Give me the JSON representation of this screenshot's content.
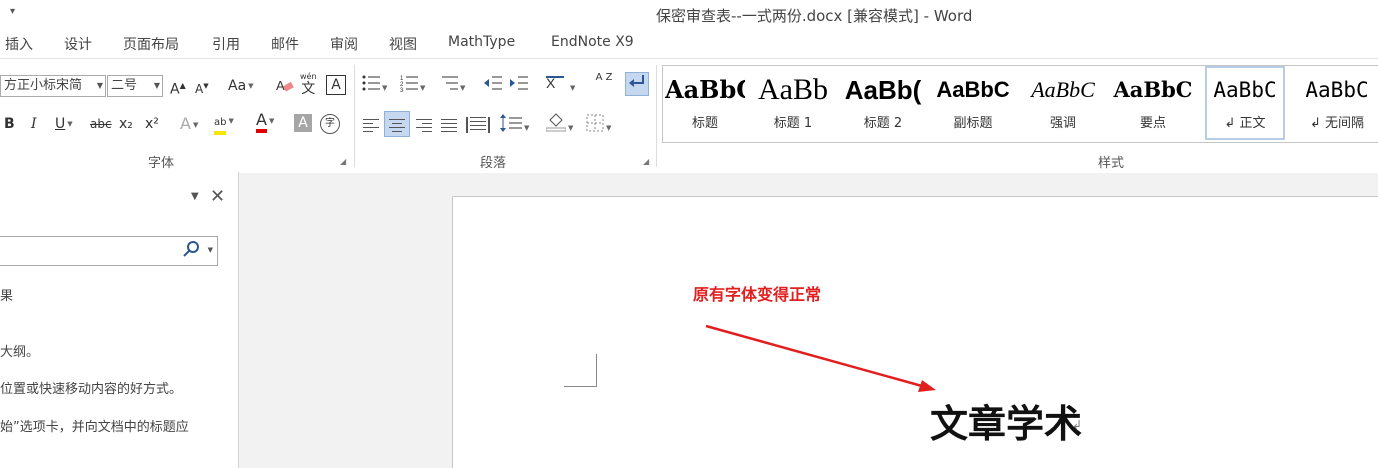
{
  "titlebar": {
    "title": "保密审查表--一式两份.docx [兼容模式] - Word"
  },
  "tabs": [
    "插入",
    "设计",
    "页面布局",
    "引用",
    "邮件",
    "审阅",
    "视图",
    "MathType",
    "EndNote X9"
  ],
  "font": {
    "font_name": "方正小标宋简",
    "font_size": "二号",
    "grow_label": "A",
    "shrink_label": "A",
    "case_label": "Aa",
    "wen_label": "wén",
    "wen_char": "文",
    "border_char": "A",
    "bold": "B",
    "italic": "I",
    "underline": "U",
    "strike": "abc",
    "sub": "x₂",
    "sup": "x²",
    "effects": "A",
    "highlight": "ab",
    "font_color": "A",
    "shading": "A",
    "circled": "字",
    "group_label": "字体"
  },
  "paragraph": {
    "group_label": "段落",
    "sort_az": "A Z",
    "highlight_color": "#c5d8ef"
  },
  "styles": {
    "group_label": "样式",
    "items": [
      {
        "preview": "AaBbC",
        "name": "标题"
      },
      {
        "preview": "AaBb",
        "name": "标题 1"
      },
      {
        "preview": "AaBb(",
        "name": "标题 2"
      },
      {
        "preview": "AaBbC",
        "name": "副标题"
      },
      {
        "preview": "AaBbC",
        "name": "强调"
      },
      {
        "preview": "AaBbC",
        "name": "要点"
      },
      {
        "preview": "AaBbC",
        "name": "↲ 正文"
      },
      {
        "preview": "AaBbC",
        "name": "↲ 无间隔"
      }
    ]
  },
  "navpane": {
    "lines": [
      "果",
      "大纲。",
      "位置或快速移动内容的好方式。",
      "始”选项卡，并向文档中的标题应"
    ]
  },
  "document": {
    "annotation": "原有字体变得正常",
    "heading": "文章学术",
    "annotation_color": "#e21f1f"
  }
}
